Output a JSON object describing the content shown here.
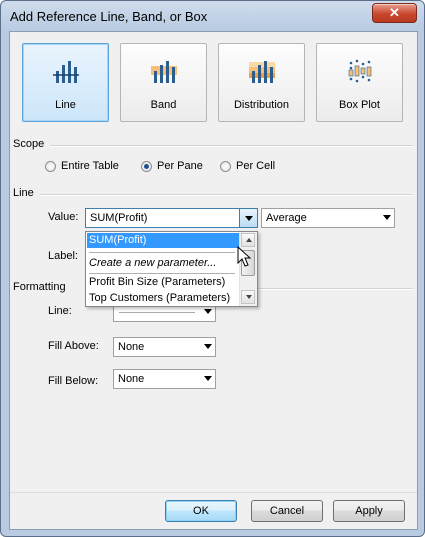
{
  "window": {
    "title": "Add Reference Line, Band, or Box",
    "close_glyph": "✕"
  },
  "types": [
    {
      "label": "Line",
      "icon": "line-icon",
      "selected": true
    },
    {
      "label": "Band",
      "icon": "band-icon",
      "selected": false
    },
    {
      "label": "Distribution",
      "icon": "distribution-icon",
      "selected": false
    },
    {
      "label": "Box Plot",
      "icon": "box-plot-icon",
      "selected": false
    }
  ],
  "scope": {
    "heading": "Scope",
    "options": [
      "Entire Table",
      "Per Pane",
      "Per Cell"
    ],
    "selected": "Per Pane"
  },
  "line": {
    "heading": "Line",
    "value_label": "Value:",
    "value_selected": "SUM(Profit)",
    "aggregation": "Average",
    "label_label": "Label:",
    "dropdown_items": [
      "SUM(Profit)",
      "Create a new parameter...",
      "Profit Bin Size (Parameters)",
      "Top Customers (Parameters)"
    ]
  },
  "formatting": {
    "heading": "Formatting",
    "line_label": "Line:",
    "fill_above_label": "Fill Above:",
    "fill_above_value": "None",
    "fill_below_label": "Fill Below:",
    "fill_below_value": "None"
  },
  "buttons": {
    "ok": "OK",
    "cancel": "Cancel",
    "apply": "Apply"
  },
  "colors": {
    "accent_blue": "#3399ff",
    "bar_orange": "#f0a040",
    "icon_blue": "#2b5d8f"
  }
}
